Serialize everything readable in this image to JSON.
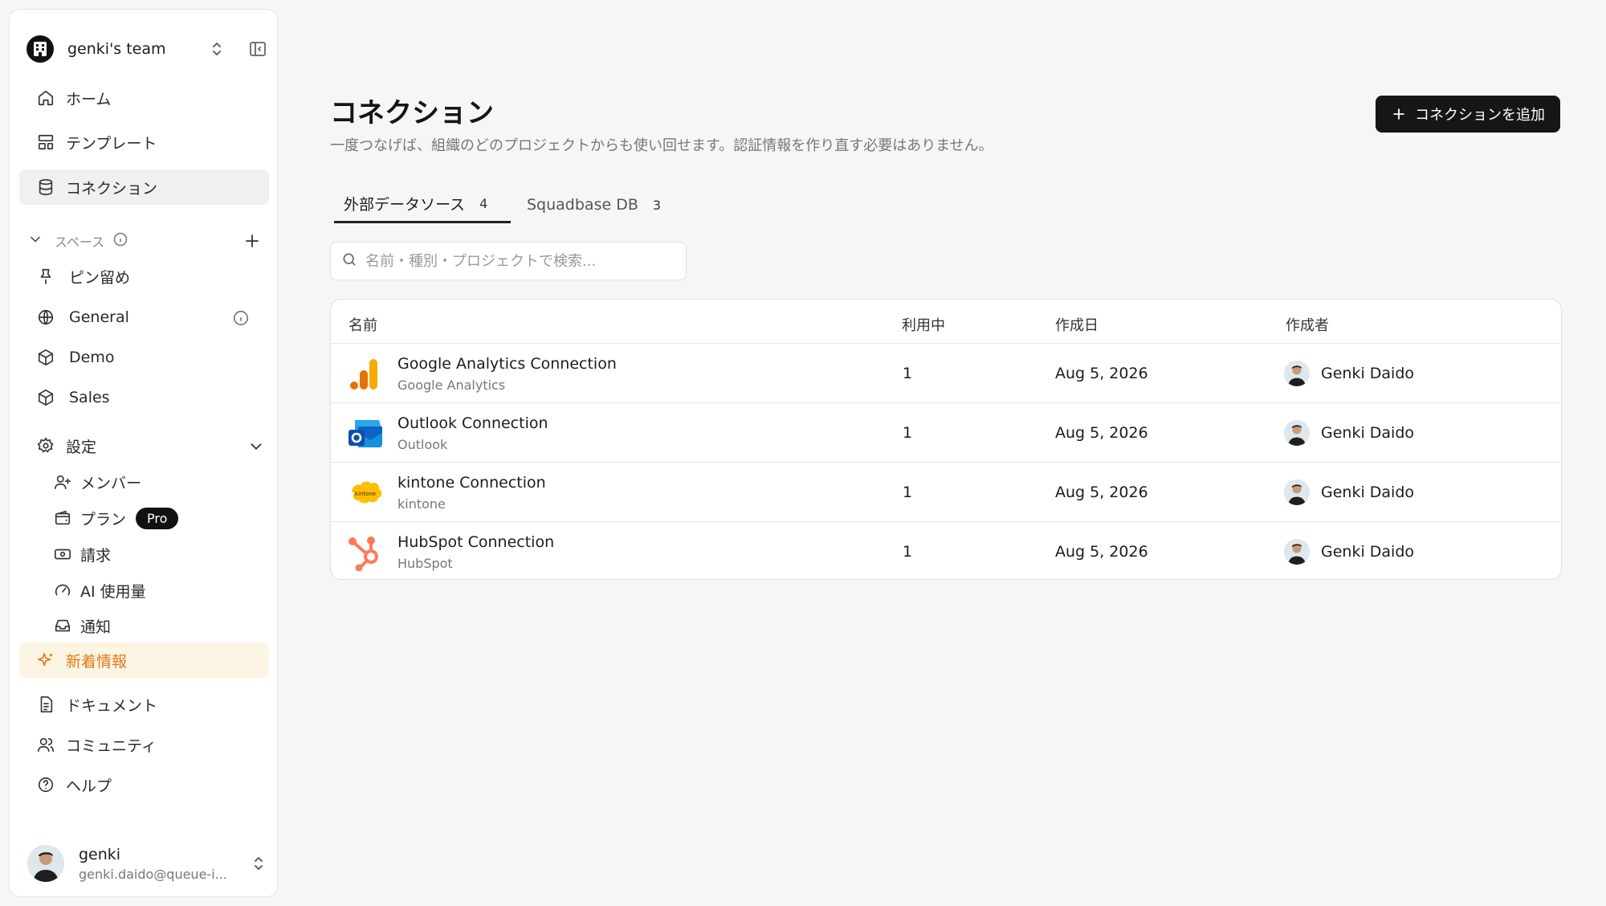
{
  "team": {
    "name": "genki's team"
  },
  "nav": {
    "home": "ホーム",
    "templates": "テンプレート",
    "connections": "コネクション"
  },
  "spaces": {
    "header": "スペース",
    "items": [
      "ピン留め",
      "General",
      "Demo",
      "Sales"
    ]
  },
  "settings": {
    "label": "設定",
    "items": [
      "メンバー",
      "プラン",
      "請求",
      "AI 使用量",
      "通知"
    ],
    "plan_badge": "Pro"
  },
  "bottom_nav": {
    "news": "新着情報",
    "docs": "ドキュメント",
    "community": "コミュニティ",
    "help": "ヘルプ"
  },
  "user": {
    "name": "genki",
    "email": "genki.daido@queue-i..."
  },
  "page": {
    "title": "コネクション",
    "description": "一度つなげば、組織のどのプロジェクトからも使い回せます。認証情報を作り直す必要はありません。",
    "add_button": "コネクションを追加"
  },
  "tabs": [
    {
      "label": "外部データソース",
      "count": "4"
    },
    {
      "label": "Squadbase DB",
      "count": "3"
    }
  ],
  "search": {
    "placeholder": "名前・種別・プロジェクトで検索..."
  },
  "table": {
    "headers": [
      "名前",
      "利用中",
      "作成日",
      "作成者"
    ],
    "rows": [
      {
        "name": "Google Analytics Connection",
        "type": "Google Analytics",
        "in_use": "1",
        "created": "Aug 5, 2026",
        "creator": "Genki Daido",
        "logo": "google-analytics-logo"
      },
      {
        "name": "Outlook Connection",
        "type": "Outlook",
        "in_use": "1",
        "created": "Aug 5, 2026",
        "creator": "Genki Daido",
        "logo": "outlook-logo"
      },
      {
        "name": "kintone Connection",
        "type": "kintone",
        "in_use": "1",
        "created": "Aug 5, 2026",
        "creator": "Genki Daido",
        "logo": "kintone-logo"
      },
      {
        "name": "HubSpot Connection",
        "type": "HubSpot",
        "in_use": "1",
        "created": "Aug 5, 2026",
        "creator": "Genki Daido",
        "logo": "hubspot-logo"
      }
    ]
  },
  "colors": {
    "accent_orange": "#e07a1a",
    "news_bg": "#fdf5e4",
    "button_bg": "#161616",
    "page_bg": "#f6f6f6"
  }
}
